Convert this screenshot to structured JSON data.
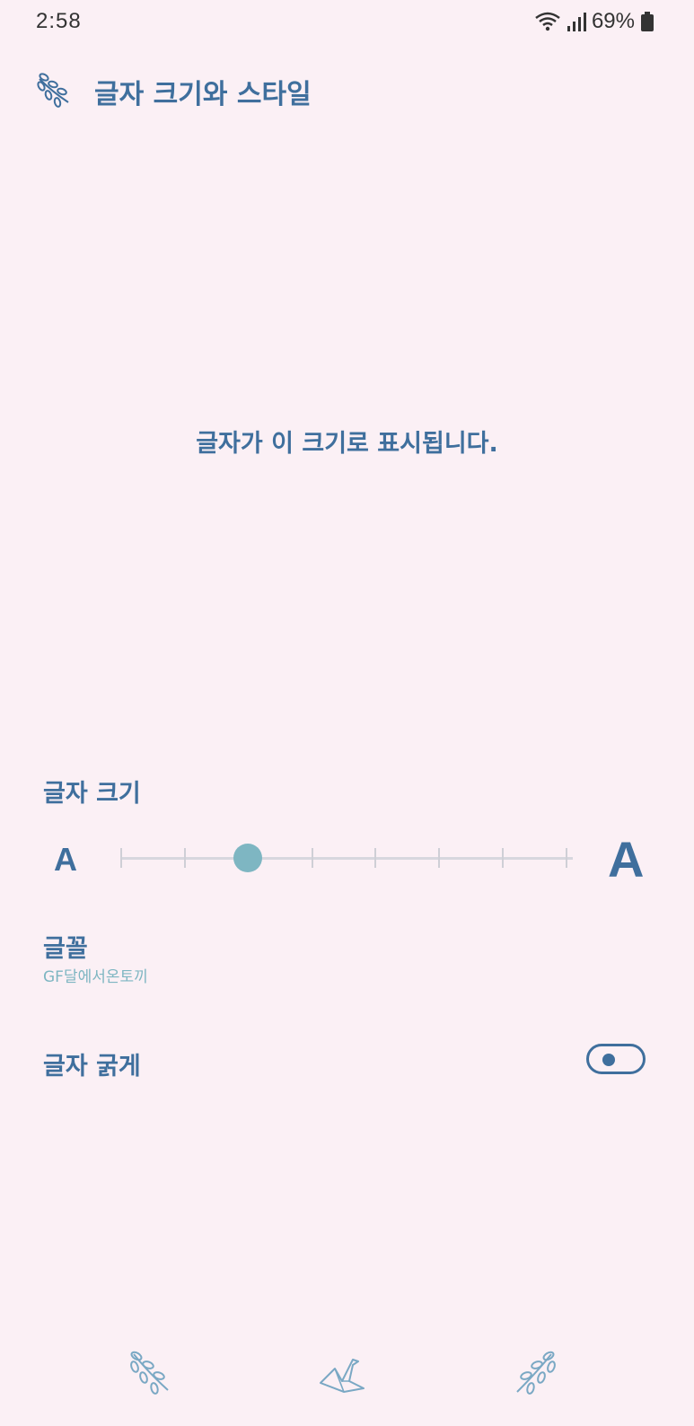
{
  "status_bar": {
    "time": "2:58",
    "battery": "69%",
    "icons": [
      "wifi-icon",
      "signal-icon",
      "battery-icon"
    ]
  },
  "header": {
    "title": "글자 크기와 스타일",
    "icon": "leaf-icon"
  },
  "preview": {
    "text": "글자가 이 크기로 표시됩니다."
  },
  "font_size": {
    "label": "글자 크기",
    "small_label": "A",
    "large_label": "A",
    "steps": 8,
    "current_step": 2
  },
  "font": {
    "label": "글꼴",
    "value": "GF달에서온토끼"
  },
  "bold": {
    "label": "글자 굵게",
    "enabled": false
  },
  "bottom_nav": {
    "items": [
      "leaf-icon",
      "origami-bird-icon",
      "leaf-icon"
    ]
  },
  "colors": {
    "background": "#fbf0f5",
    "primary": "#3f6f9d",
    "accent": "#7eb6c2"
  }
}
